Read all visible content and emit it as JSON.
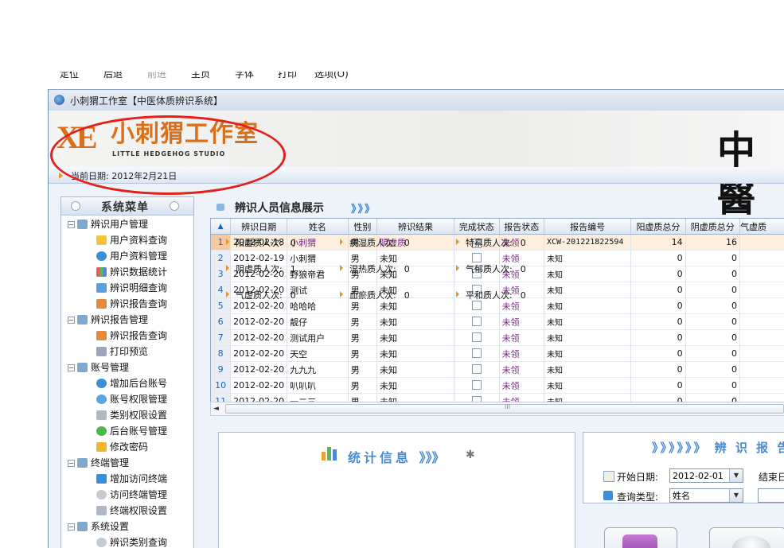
{
  "browser_menu": [
    "定位",
    "后退",
    "前进",
    "主页",
    "字体",
    "打印",
    "选项(O)"
  ],
  "window": {
    "title": "小刺猬工作室【中医体质辨识系统】"
  },
  "banner": {
    "logo_mark": "XE",
    "logo_cn": "小刺猬工作室",
    "logo_en": "LITTLE HEDGEHOG STUDIO",
    "big_char": "中醫",
    "current_date": "当前日期: 2012年2月21日"
  },
  "sidebar": {
    "title": "系统菜单",
    "groups": [
      {
        "label": "辨识用户管理",
        "items": [
          "用户资料查询",
          "用户资料管理",
          "辨识数据统计",
          "辨识明细查询",
          "辨识报告查询"
        ]
      },
      {
        "label": "辨识报告管理",
        "items": [
          "辨识报告查询",
          "打印预览"
        ]
      },
      {
        "label": "账号管理",
        "items": [
          "增加后台账号",
          "账号权限管理",
          "类别权限设置",
          "后台账号管理",
          "修改密码"
        ]
      },
      {
        "label": "终端管理",
        "items": [
          "增加访问终端",
          "访问终端管理",
          "终端权限设置"
        ]
      },
      {
        "label": "系统设置",
        "items": [
          "辨识类别查询"
        ]
      }
    ]
  },
  "main": {
    "title": "辨识人员信息展示",
    "chevrons": "》》》"
  },
  "grid": {
    "sort_glyph": "▲",
    "columns": [
      "辨识日期",
      "姓名",
      "性别",
      "辨识结果",
      "完成状态",
      "报告状态",
      "报告编号",
      "阳虚质总分",
      "阴虚质总分",
      "气虚质"
    ],
    "rows": [
      {
        "idx": "1",
        "date": "2012-02-18",
        "name": "小刺猬",
        "sex": "男",
        "result": "阴虚质",
        "done": true,
        "report": "未领",
        "code": "XCW-201221822594",
        "yang": "14",
        "yin": "16"
      },
      {
        "idx": "2",
        "date": "2012-02-19",
        "name": "小刺猬",
        "sex": "男",
        "result": "未知",
        "done": false,
        "report": "未领",
        "code": "未知",
        "yang": "0",
        "yin": "0"
      },
      {
        "idx": "3",
        "date": "2012-02-20",
        "name": "野狼帝君",
        "sex": "男",
        "result": "未知",
        "done": false,
        "report": "未领",
        "code": "未知",
        "yang": "0",
        "yin": "0"
      },
      {
        "idx": "4",
        "date": "2012-02-20",
        "name": "测试",
        "sex": "男",
        "result": "未知",
        "done": false,
        "report": "未领",
        "code": "未知",
        "yang": "0",
        "yin": "0"
      },
      {
        "idx": "5",
        "date": "2012-02-20",
        "name": "哈哈哈",
        "sex": "男",
        "result": "未知",
        "done": false,
        "report": "未领",
        "code": "未知",
        "yang": "0",
        "yin": "0"
      },
      {
        "idx": "6",
        "date": "2012-02-20",
        "name": "靓仔",
        "sex": "男",
        "result": "未知",
        "done": false,
        "report": "未领",
        "code": "未知",
        "yang": "0",
        "yin": "0"
      },
      {
        "idx": "7",
        "date": "2012-02-20",
        "name": "测试用户",
        "sex": "男",
        "result": "未知",
        "done": false,
        "report": "未领",
        "code": "未知",
        "yang": "0",
        "yin": "0"
      },
      {
        "idx": "8",
        "date": "2012-02-20",
        "name": "天空",
        "sex": "男",
        "result": "未知",
        "done": false,
        "report": "未领",
        "code": "未知",
        "yang": "0",
        "yin": "0"
      },
      {
        "idx": "9",
        "date": "2012-02-20",
        "name": "九九九",
        "sex": "男",
        "result": "未知",
        "done": false,
        "report": "未领",
        "code": "未知",
        "yang": "0",
        "yin": "0"
      },
      {
        "idx": "10",
        "date": "2012-02-20",
        "name": "叭叭叭",
        "sex": "男",
        "result": "未知",
        "done": false,
        "report": "未领",
        "code": "未知",
        "yang": "0",
        "yin": "0"
      },
      {
        "idx": "11",
        "date": "2012-02-20",
        "name": "一二三",
        "sex": "男",
        "result": "未知",
        "done": false,
        "report": "未领",
        "code": "未知",
        "yang": "0",
        "yin": "0"
      }
    ],
    "scroll_grip": "III",
    "scroll_left": "◄"
  },
  "stats": {
    "title": "统计信息",
    "title_chev": "》》》",
    "items": [
      {
        "label": "阳虚质人次:",
        "value": "0"
      },
      {
        "label": "痰湿质人次:",
        "value": "0"
      },
      {
        "label": "特禀质人次:",
        "value": "0"
      },
      {
        "label": "阴虚质人次:",
        "value": "1"
      },
      {
        "label": "湿热质人次:",
        "value": "0"
      },
      {
        "label": "气郁质人次:",
        "value": "0"
      },
      {
        "label": "气虚质人次:",
        "value": "0"
      },
      {
        "label": "血瘀质人次:",
        "value": "0"
      },
      {
        "label": "平和质人次:",
        "value": "0"
      }
    ]
  },
  "report": {
    "title": "》》》》》》 辨 识 报 告",
    "start_label": "开始日期:",
    "start_value": "2012-02-01",
    "end_label": "结束日",
    "type_label": "查询类型:",
    "type_value": "姓名"
  },
  "colors": {
    "accent": "#4a8ad0",
    "logo": "#d9711c",
    "annotation": "#e3201b"
  }
}
